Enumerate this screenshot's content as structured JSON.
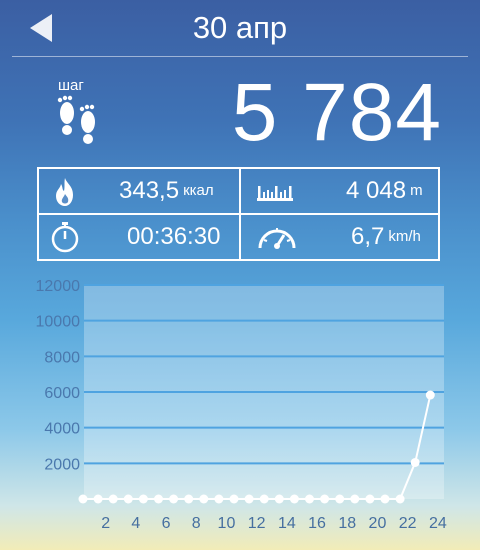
{
  "header": {
    "date": "30 апр",
    "back_icon": "back-arrow-icon"
  },
  "steps": {
    "label": "шаг",
    "count": "5 784",
    "icon": "footprints-icon"
  },
  "stats": {
    "calories": {
      "value": "343,5",
      "unit": "ккал",
      "icon": "flame-icon"
    },
    "distance": {
      "value": "4 048",
      "unit": "m",
      "icon": "ruler-icon"
    },
    "duration": {
      "value": "00:36:30",
      "icon": "stopwatch-icon"
    },
    "speed": {
      "value": "6,7",
      "unit": "km/h",
      "icon": "speedometer-icon"
    }
  },
  "chart_data": {
    "type": "line",
    "title": "",
    "xlabel": "",
    "ylabel": "",
    "x": [
      0,
      1,
      2,
      3,
      4,
      5,
      6,
      7,
      8,
      9,
      10,
      11,
      12,
      13,
      14,
      15,
      16,
      17,
      18,
      19,
      20,
      21,
      22,
      23
    ],
    "values": [
      0,
      0,
      0,
      0,
      0,
      0,
      0,
      0,
      0,
      0,
      0,
      0,
      0,
      0,
      0,
      0,
      0,
      0,
      0,
      0,
      0,
      0,
      2050,
      5830
    ],
    "xticks": [
      "2",
      "4",
      "6",
      "8",
      "10",
      "12",
      "14",
      "16",
      "18",
      "20",
      "22",
      "24"
    ],
    "yticks": [
      "2000",
      "4000",
      "6000",
      "8000",
      "10000",
      "12000"
    ],
    "ylim": [
      0,
      12000
    ],
    "grid": true
  }
}
